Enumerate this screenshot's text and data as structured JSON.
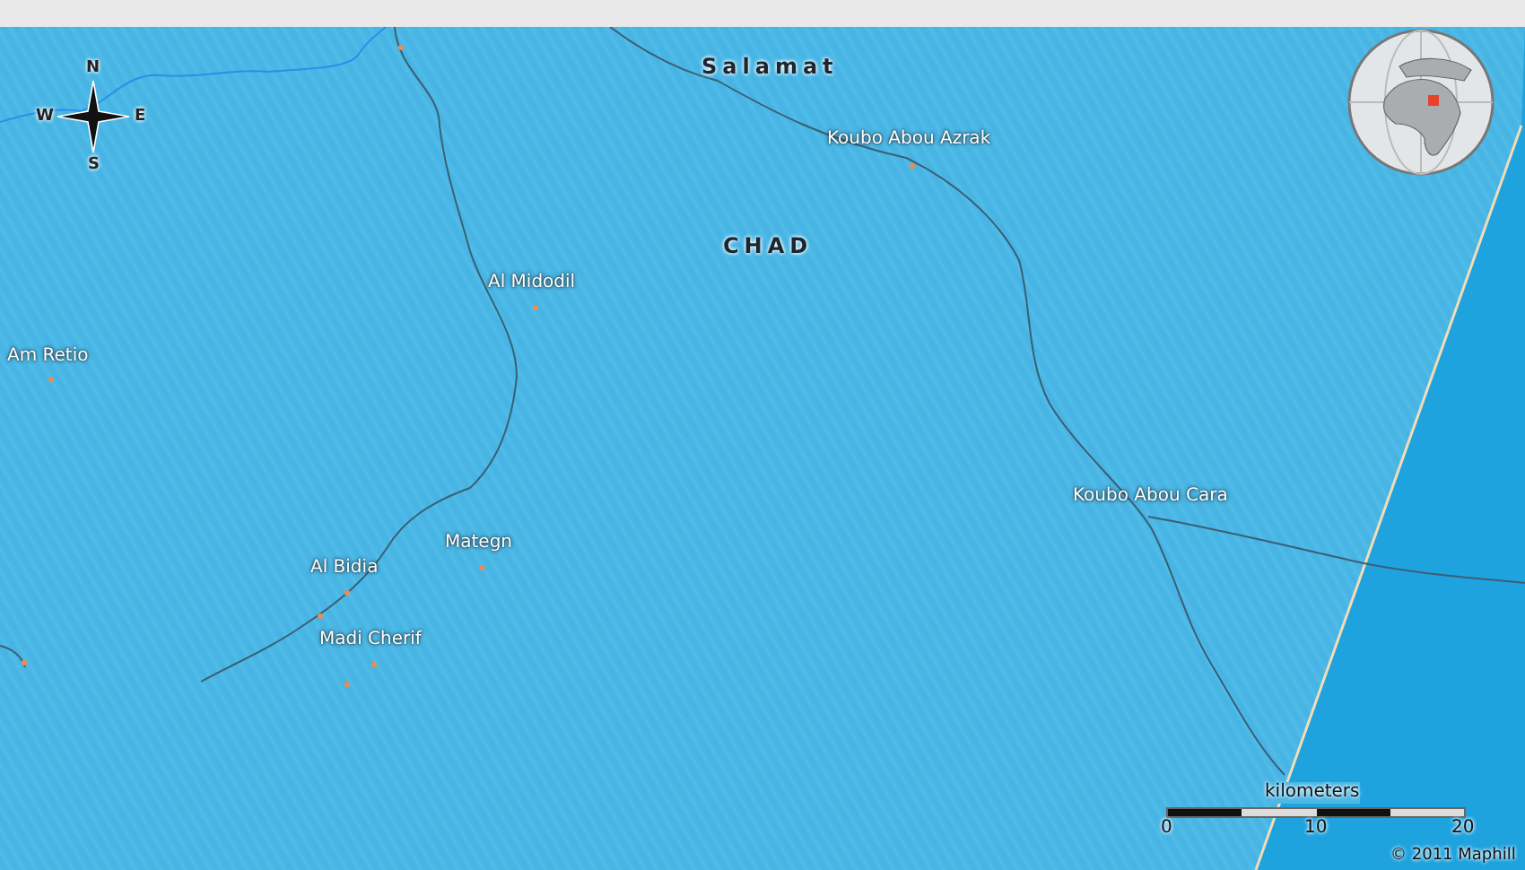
{
  "map": {
    "regions": [
      {
        "label": "Salamat"
      },
      {
        "label": "CHAD"
      }
    ],
    "places": [
      {
        "label": "Koubo Abou Azrak"
      },
      {
        "label": "Al Midodil"
      },
      {
        "label": "Am Retio"
      },
      {
        "label": "Koubo Abou Cara"
      },
      {
        "label": "Mategn"
      },
      {
        "label": "Al Bidia"
      },
      {
        "label": "Madi Cherif"
      }
    ],
    "compass": {
      "north": "N",
      "east": "E",
      "south": "S",
      "west": "W"
    },
    "scale": {
      "unit": "kilometers",
      "ticks": [
        "0",
        "10",
        "20"
      ]
    },
    "copyright": "© 2011 Maphill"
  }
}
